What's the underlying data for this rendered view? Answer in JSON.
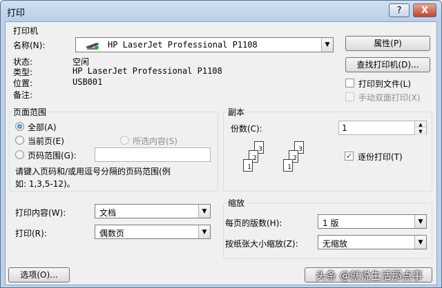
{
  "window": {
    "title": "打印",
    "help_label": "?",
    "close_label": "X"
  },
  "printer": {
    "group_label": "打印机",
    "name_label": "名称(N):",
    "name_value": "HP LaserJet Professional P1108",
    "properties_btn": "属性(P)",
    "find_btn": "查找打印机(D)...",
    "status_label": "状态:",
    "status_value": "空闲",
    "type_label": "类型:",
    "type_value": "HP LaserJet Professional P1108",
    "location_label": "位置:",
    "location_value": "USB001",
    "comment_label": "备注:",
    "print_to_file": "打印到文件(L)",
    "manual_duplex": "手动双面打印(X)"
  },
  "range": {
    "group_label": "页面范围",
    "all": "全部(A)",
    "current": "当前页(E)",
    "selection": "所选内容(S)",
    "pages": "页码范围(G):",
    "hint_line1": "请键入页码和/或用逗号分隔的页码范围(例",
    "hint_line2": "如: 1,3,5-12)。"
  },
  "copies": {
    "group_label": "副本",
    "count_label": "份数(C):",
    "count_value": "1",
    "collate": "逐份打印(T)",
    "stack1": [
      "1",
      "2",
      "3"
    ],
    "stack2": [
      "1",
      "2",
      "3"
    ]
  },
  "print_what": {
    "label": "打印内容(W):",
    "value": "文档"
  },
  "print_pages": {
    "label": "打印(R):",
    "value": "偶数页"
  },
  "zoom": {
    "group_label": "缩放",
    "per_sheet_label": "每页的版数(H):",
    "per_sheet_value": "1 版",
    "scale_label": "按纸张大小缩放(Z):",
    "scale_value": "无缩放"
  },
  "options_btn": "选项(O)...",
  "watermark": "头条 @就说生活那点事",
  "icons": {
    "dropdown": "▼",
    "check": "✓",
    "spin_up": "▲",
    "spin_down": "▼"
  }
}
